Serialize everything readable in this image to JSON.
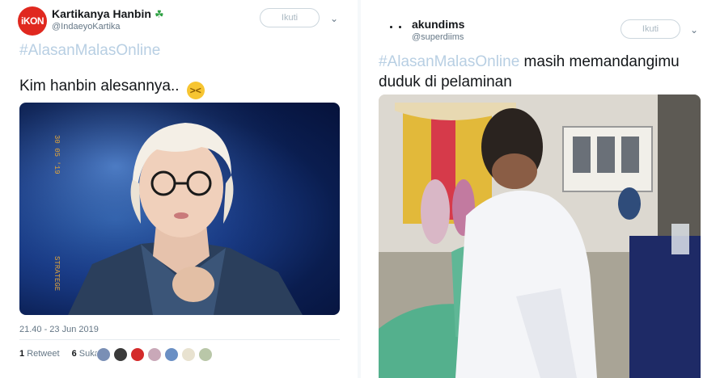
{
  "tweet_left": {
    "avatar_text": "iKON",
    "name": "Kartikanya Hanbin",
    "name_emoji": "☘",
    "handle": "@IndaeyoKartika",
    "follow_label": "Ikuti",
    "hashtag": "#AlasanMalasOnline",
    "text": "Kim hanbin alesannya..",
    "emoji": "😖",
    "timestamp": "21.40 - 23 Jun 2019",
    "retweets_count": "1",
    "retweets_label": "Retweet",
    "likes_count": "6",
    "likes_label": "Suka"
  },
  "tweet_right": {
    "name": "akundims",
    "handle": "@superdiims",
    "follow_label": "Ikuti",
    "hashtag": "#AlasanMalasOnline",
    "text_line1": "masih memandangimu",
    "text_line2": "duduk di pelaminan"
  },
  "colors": {
    "hashtag": "#b8cfe3",
    "follow_border": "#ccd6dd",
    "avatar_red": "#e0281f"
  }
}
